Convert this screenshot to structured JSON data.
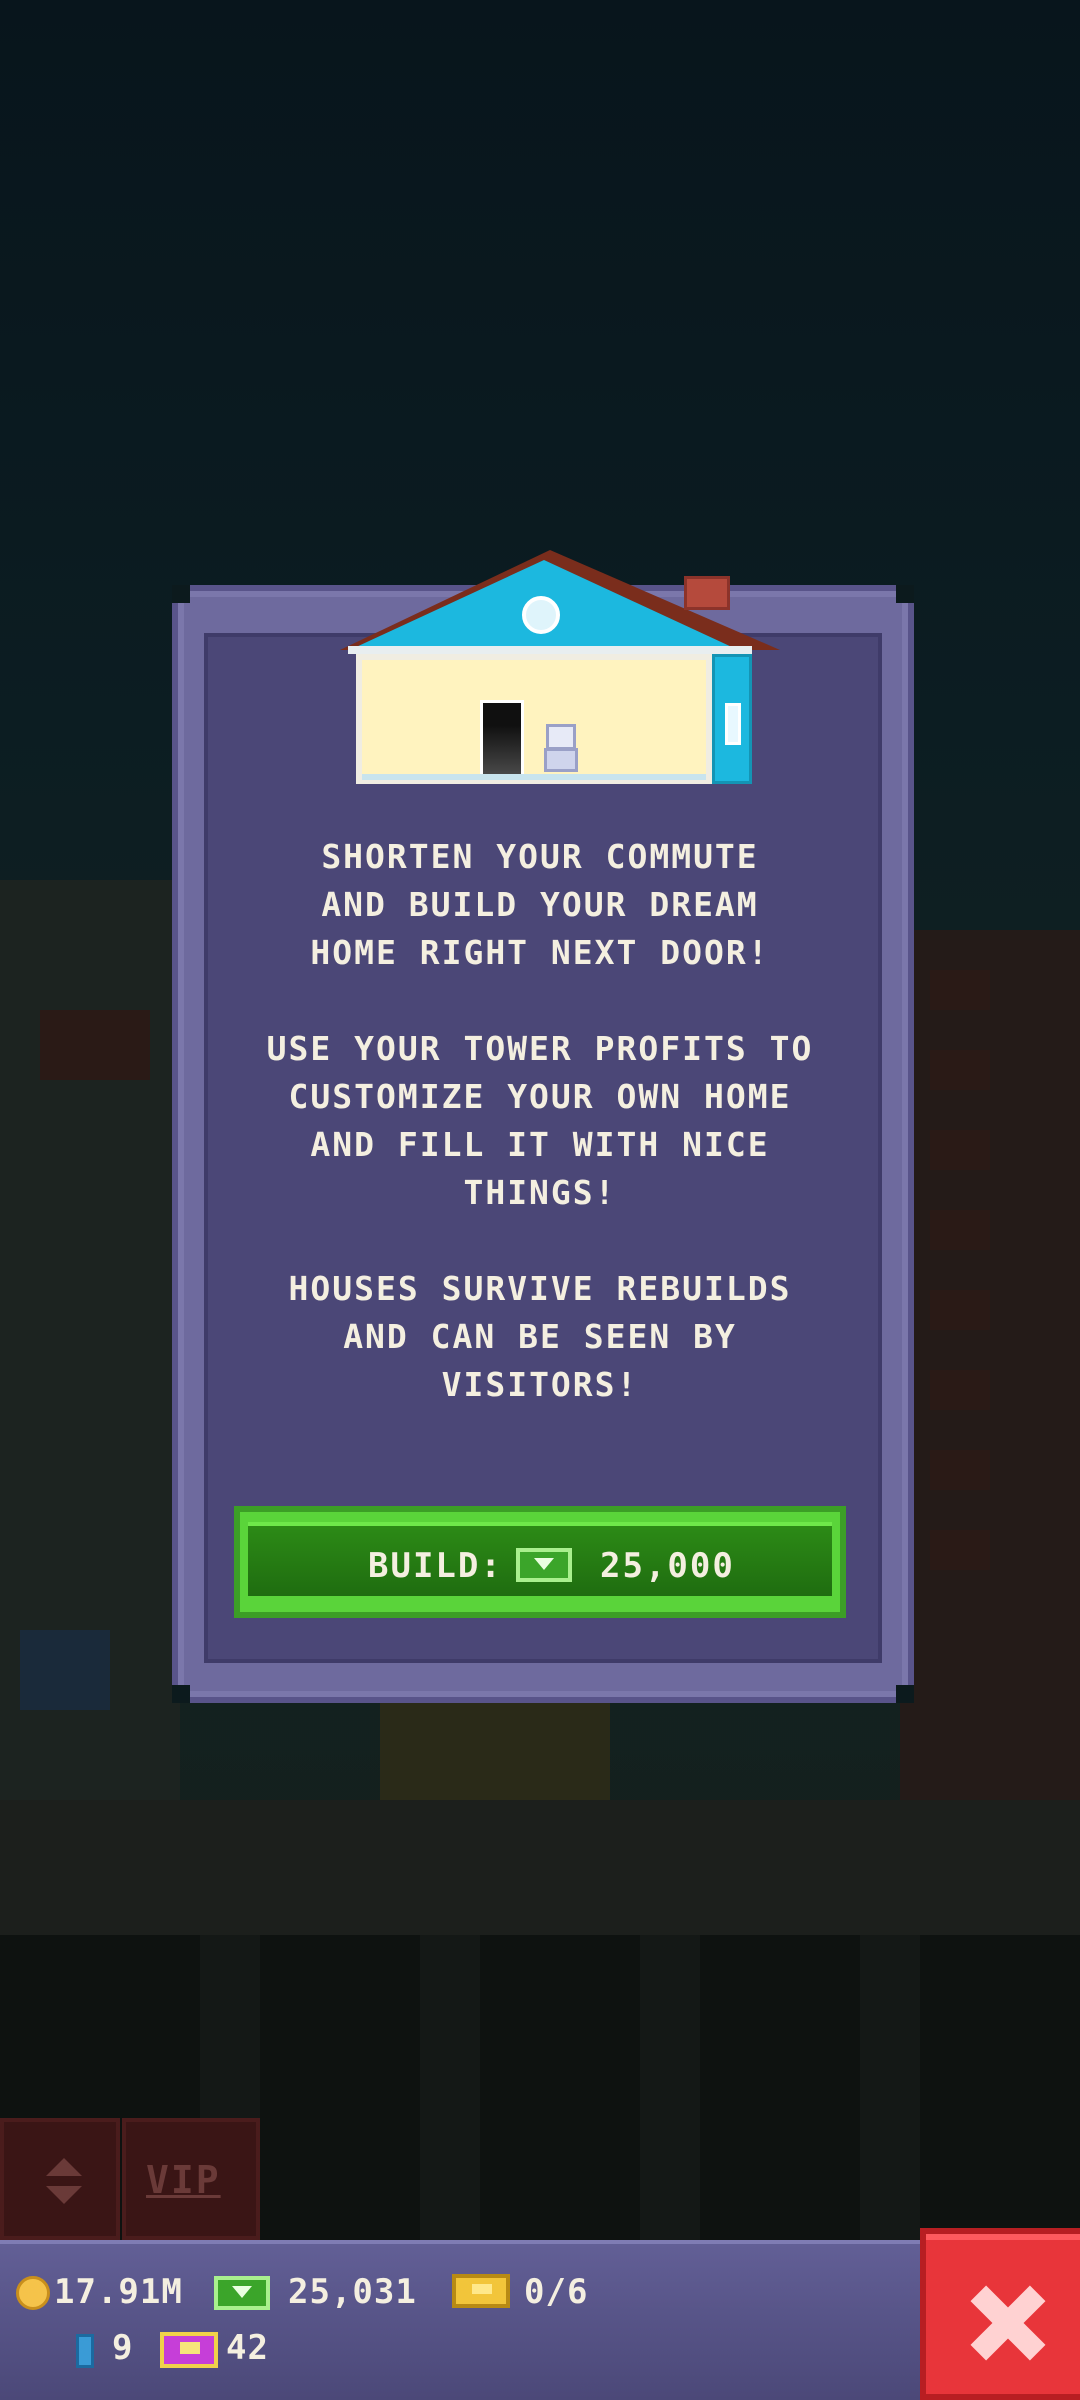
{
  "dialog": {
    "intro": "SHORTEN YOUR COMMUTE\nAND BUILD YOUR DREAM\nHOME RIGHT NEXT DOOR!",
    "profits": "USE YOUR TOWER PROFITS TO\nCUSTOMIZE YOUR OWN HOME\nAND FILL IT WITH NICE\nTHINGS!",
    "houses": "HOUSES SURVIVE REBUILDS\nAND CAN BE SEEN BY\nVISITORS!",
    "build_label": "BUILD:",
    "build_cost": "25,000",
    "build_currency_icon": "cash-icon"
  },
  "side_buttons": {
    "vip_label": "VIP"
  },
  "status": {
    "coins": "17.91M",
    "cash": "25,031",
    "tickets": "0/6",
    "keys": "9",
    "bux": "42",
    "icons": [
      "coin-icon",
      "cash-icon",
      "ticket-icon",
      "key-icon",
      "bux-icon",
      "close-icon"
    ]
  },
  "colors": {
    "dialog_bg": "#4b4777",
    "build_green": "#2c8a16",
    "close_red": "#e8353a",
    "status_bar": "#625f96"
  }
}
